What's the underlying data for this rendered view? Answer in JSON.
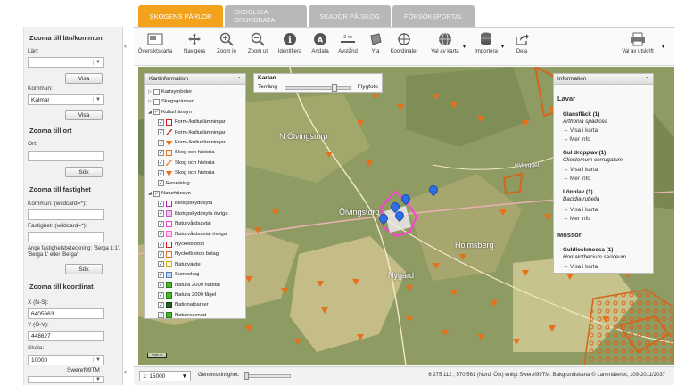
{
  "tabs": [
    {
      "label": "SKOGENS PÄRLOR",
      "active": true
    },
    {
      "label": "SKOGLIGA GRUNDDATA",
      "active": false
    },
    {
      "label": "SKADOR PÅ SKOG",
      "active": false
    },
    {
      "label": "FÖRSÖKSPORTAL",
      "active": false
    }
  ],
  "toolbar": {
    "oversikt": "Översiktskarta",
    "navigera": "Navigera",
    "zoom_in": "Zoom in",
    "zoom_ut": "Zoom ut",
    "identifiera": "Identifiera",
    "artdata": "Artdata",
    "avstand": "Avstånd",
    "yta": "Yta",
    "koordinater": "Koordinater",
    "val_av_karta": "Val av karta",
    "importera": "Importera",
    "dela": "Dela",
    "val_av_utskrift": "Val av utskrift"
  },
  "left": {
    "sec1_title": "Zooma till län/kommun",
    "lan_label": "Län:",
    "lan_value": "",
    "visa1": "Visa",
    "kommun_label": "Kommun:",
    "kommun_value": "Kalmar",
    "visa2": "Visa",
    "sec2_title": "Zooma till ort",
    "ort_label": "Ort:",
    "ort_value": "",
    "sok1": "Sök",
    "sec3_title": "Zooma till fastighet",
    "fk_label": "Kommun: (wildcard=*):",
    "fk_value": "",
    "fast_label": "Fastighet: (wildcard=*):",
    "fast_value": "",
    "hint": "Ange fastighetsbeteckning: 'Berga 1:1', 'Berga 1' eller 'Berga'",
    "sok2": "Sök",
    "sec4_title": "Zooma till koordinat",
    "x_label": "X (N-S):",
    "x_value": "6405663",
    "y_label": "Y (Ö-V):",
    "y_value": "448627",
    "skala_label": "Skala:",
    "skala_value": "10000",
    "crs": "Sweref99TM"
  },
  "kartinfo": {
    "title": "Kartinformation",
    "layers": [
      {
        "label": "Kartsymboler",
        "checked": false,
        "level": 0,
        "swatch": "",
        "tri": "▷"
      },
      {
        "label": "Skogsgränser",
        "checked": false,
        "level": 0,
        "swatch": "",
        "tri": "▷"
      },
      {
        "label": "Kulturhänsyn",
        "checked": true,
        "level": 0,
        "swatch": "",
        "tri": "◢"
      },
      {
        "label": "Form-/kulturlämningar",
        "checked": true,
        "level": 1,
        "swatch": "square-red",
        "tri": ""
      },
      {
        "label": "Form-/kulturlämningar",
        "checked": true,
        "level": 1,
        "swatch": "line-red",
        "tri": ""
      },
      {
        "label": "Form-/kulturlämningar",
        "checked": true,
        "level": 1,
        "swatch": "triangle-orange",
        "tri": ""
      },
      {
        "label": "Skog och historia",
        "checked": true,
        "level": 1,
        "swatch": "square-orange",
        "tri": ""
      },
      {
        "label": "Skog och historia",
        "checked": true,
        "level": 1,
        "swatch": "line-orange",
        "tri": ""
      },
      {
        "label": "Skog och historia",
        "checked": true,
        "level": 1,
        "swatch": "triangle-orange",
        "tri": ""
      },
      {
        "label": "Rennäring",
        "checked": true,
        "level": 1,
        "swatch": "",
        "tri": ""
      },
      {
        "label": "Naturhänsyn",
        "checked": true,
        "level": 0,
        "swatch": "",
        "tri": "◢"
      },
      {
        "label": "Biotopskyddsyta",
        "checked": true,
        "level": 1,
        "swatch": "square-magenta",
        "tri": ""
      },
      {
        "label": "Biotopskyddsyta övriga",
        "checked": true,
        "level": 1,
        "swatch": "square-magenta-light",
        "tri": ""
      },
      {
        "label": "Naturvårdsavtal",
        "checked": true,
        "level": 1,
        "swatch": "square-pink",
        "tri": ""
      },
      {
        "label": "Naturvårdsavtal övriga",
        "checked": true,
        "level": 1,
        "swatch": "square-pink-light",
        "tri": ""
      },
      {
        "label": "Nyckelbiotop",
        "checked": true,
        "level": 1,
        "swatch": "square-red",
        "tri": ""
      },
      {
        "label": "Nyckelbiotop bolag",
        "checked": true,
        "level": 1,
        "swatch": "square-orange",
        "tri": ""
      },
      {
        "label": "Naturvärde",
        "checked": true,
        "level": 1,
        "swatch": "square-yellow",
        "tri": ""
      },
      {
        "label": "Sumpskog",
        "checked": true,
        "level": 1,
        "swatch": "square-blue",
        "tri": ""
      },
      {
        "label": "Natura 2000 habitat",
        "checked": true,
        "level": 1,
        "swatch": "square-green",
        "tri": ""
      },
      {
        "label": "Natura 2000 fågel",
        "checked": true,
        "level": 1,
        "swatch": "square-green",
        "tri": ""
      },
      {
        "label": "Nationalparker",
        "checked": true,
        "level": 1,
        "swatch": "square-darkgreen",
        "tri": ""
      },
      {
        "label": "Naturreservat",
        "checked": true,
        "level": 1,
        "swatch": "square-green",
        "tri": ""
      }
    ]
  },
  "kartan": {
    "title": "Kartan",
    "left_label": "Terräng",
    "right_label": "Flygfoto",
    "blend": 0.75
  },
  "info": {
    "title": "Information",
    "cat1": "Lavar",
    "s1_name": "Glansfläck (1)",
    "s1_sci": "Arthonia spadicea",
    "s2_name": "Gul dropplav (1)",
    "s2_sci": "Cliostomum corrugatum",
    "s3_name": "Lönnlav (1)",
    "s3_sci": "Bacidia rubella",
    "cat2": "Mossor",
    "s4_name": "Guldlockmossa (1)",
    "s4_sci": "Homalothecium sericeum",
    "visa": "→  Visa i karta",
    "mer": "→  Mer info"
  },
  "map_labels": {
    "place1": "N Ölvingstorp",
    "place2": "Ölvingstorp",
    "place3": "Nybygget",
    "place4": "Holmsberg",
    "place5": "Nygård",
    "scalebar": "200 m"
  },
  "bottom": {
    "scale": "1: 15000",
    "gen_label": "Genomskinlighet:",
    "transparency": 0.0,
    "coords": "6 275 112 , 570 561 (Nord, Öst) enligt Sweref99TM. Bakgrundskarta © Lantmäteriet, 109-2011/2037"
  },
  "colors": {
    "accent": "#f3a21c",
    "marker": "#e8701a",
    "pin": "#2f6fe6",
    "highlight": "#ff3fd2"
  }
}
